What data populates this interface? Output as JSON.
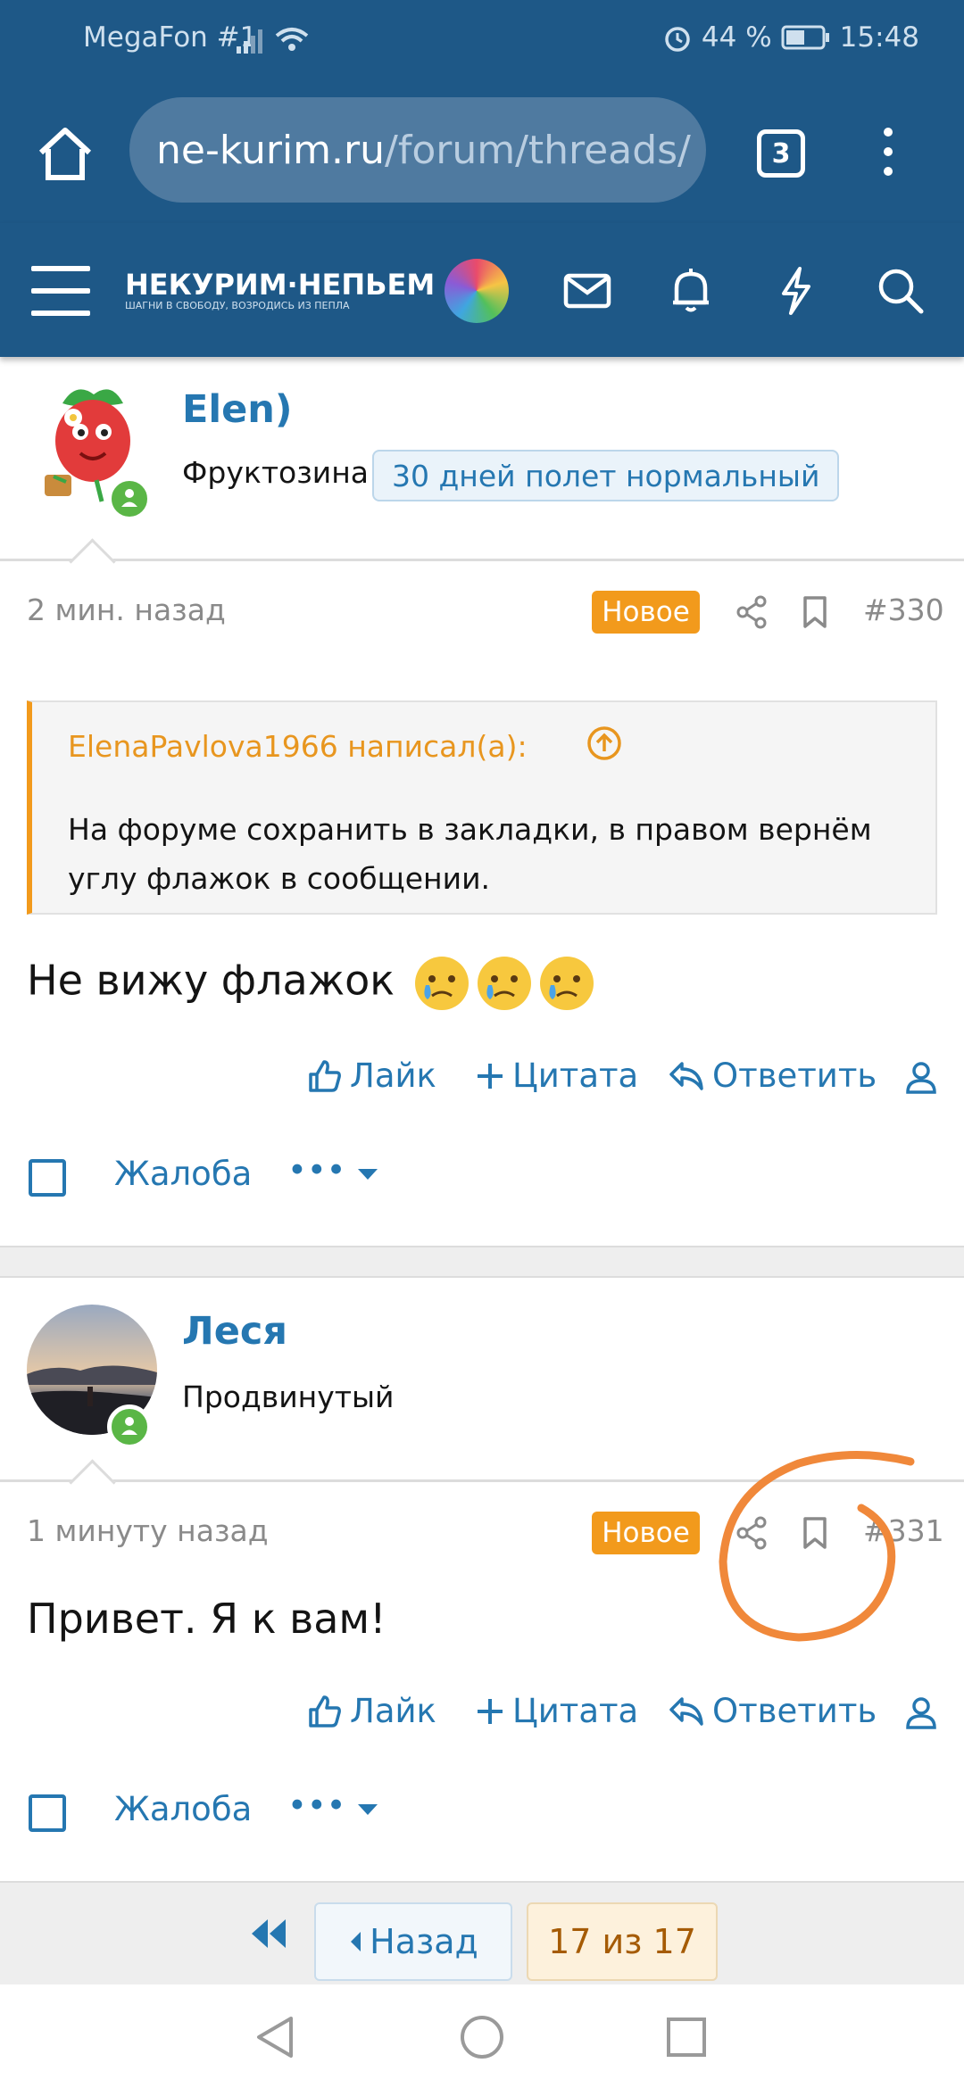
{
  "status_bar": {
    "carrier": "MegaFon #1",
    "battery": "44 %",
    "time": "15:48"
  },
  "browser": {
    "url_domain": "ne-kurim.ru",
    "url_path": "/forum/threads/",
    "tab_count": "3"
  },
  "site_header": {
    "logo_main": "НЕКУРИМ·НЕПЬЕМ",
    "logo_sub": "ШАГНИ В СВОБОДУ, ВОЗРОДИСЬ ИЗ ПЕПЛА"
  },
  "posts": [
    {
      "username": "Elen)",
      "user_title": "Фруктозина",
      "banner": "30 дней полет нормальный",
      "time": "2 мин. назад",
      "badge": "Новое",
      "number": "#330",
      "quote_author": "ElenaPavlova1966 написал(а):",
      "quote_text": "На форуме сохранить в закладки, в правом вернём углу флажок в сообщении.",
      "text": "Не вижу флажок",
      "emoji": [
        "crying-face",
        "crying-face",
        "crying-face"
      ]
    },
    {
      "username": "Леся",
      "user_title": "Продвинутый",
      "time": "1 минуту назад",
      "badge": "Новое",
      "number": "#331",
      "text": "Привет. Я к вам!"
    }
  ],
  "actions": {
    "like": "Лайк",
    "quote": "Цитата",
    "reply": "Ответить",
    "report": "Жалоба",
    "more": "•••"
  },
  "pagination": {
    "back": "Назад",
    "current": "17 из 17"
  },
  "colors": {
    "header": "#1e5887",
    "link": "#2577b1",
    "new_badge": "#f29a1c",
    "annotation": "#f0883a"
  }
}
